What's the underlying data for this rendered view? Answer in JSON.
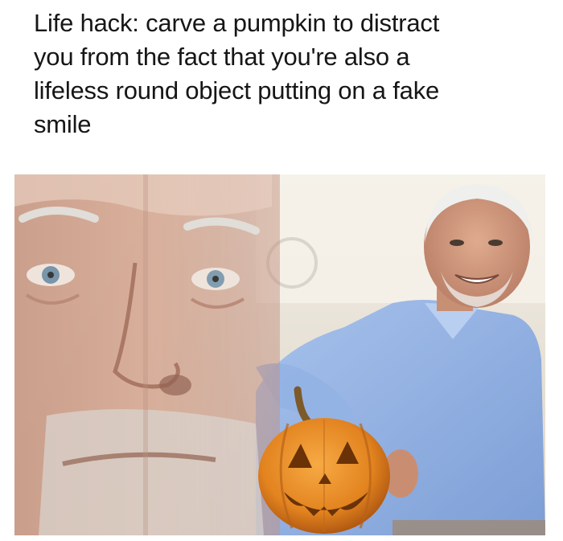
{
  "caption": {
    "line1": "Life hack: carve a pumpkin to distract",
    "line2": "you from the fact that you're also a",
    "line3": "lifeless round object putting on a fake",
    "line4": "smile"
  },
  "image": {
    "subjects": [
      "old-man-face-closeup",
      "smiling-old-man",
      "jack-o-lantern-pumpkin"
    ],
    "colors": {
      "background": "#ffffff",
      "text": "#161616",
      "shirt_blue": "#8fb0e0",
      "skin": "#d9a88e",
      "pumpkin_orange": "#e88a2a",
      "pumpkin_dark": "#a04d10",
      "room_light": "#ece6dc"
    }
  }
}
